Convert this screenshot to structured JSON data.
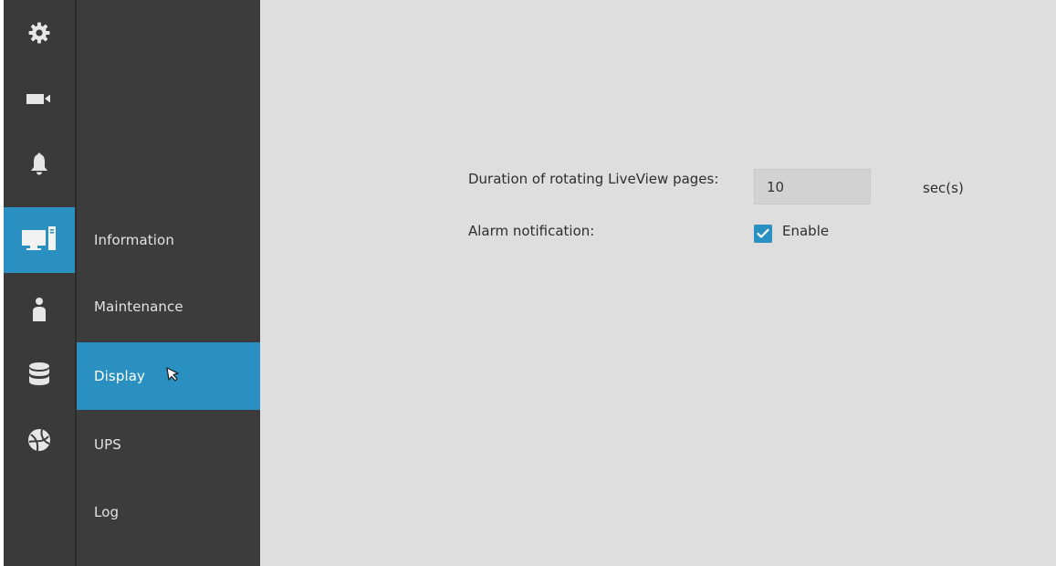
{
  "rail": {
    "items": [
      {
        "icon": "gear-icon",
        "active": false
      },
      {
        "icon": "video-camera-icon",
        "active": false
      },
      {
        "icon": "bell-icon",
        "active": false
      },
      {
        "icon": "monitor-icon",
        "active": true
      },
      {
        "icon": "user-icon",
        "active": false
      },
      {
        "icon": "database-icon",
        "active": false
      },
      {
        "icon": "globe-icon",
        "active": false
      }
    ]
  },
  "submenu": {
    "items": [
      {
        "label": "Information"
      },
      {
        "label": "Maintenance"
      },
      {
        "label": "Display",
        "active": true
      },
      {
        "label": "UPS"
      },
      {
        "label": "Log"
      }
    ]
  },
  "settings": {
    "duration_label": "Duration of rotating LiveView pages:",
    "duration_value": "10",
    "duration_unit": "sec(s)",
    "alarm_label": "Alarm notification:",
    "alarm_enable_label": "Enable",
    "alarm_enabled": true
  },
  "colors": {
    "accent": "#2a8fc1",
    "rail_bg": "#3a3a3a",
    "menu_bg": "#3c3c3c",
    "panel_bg": "#dedede"
  }
}
